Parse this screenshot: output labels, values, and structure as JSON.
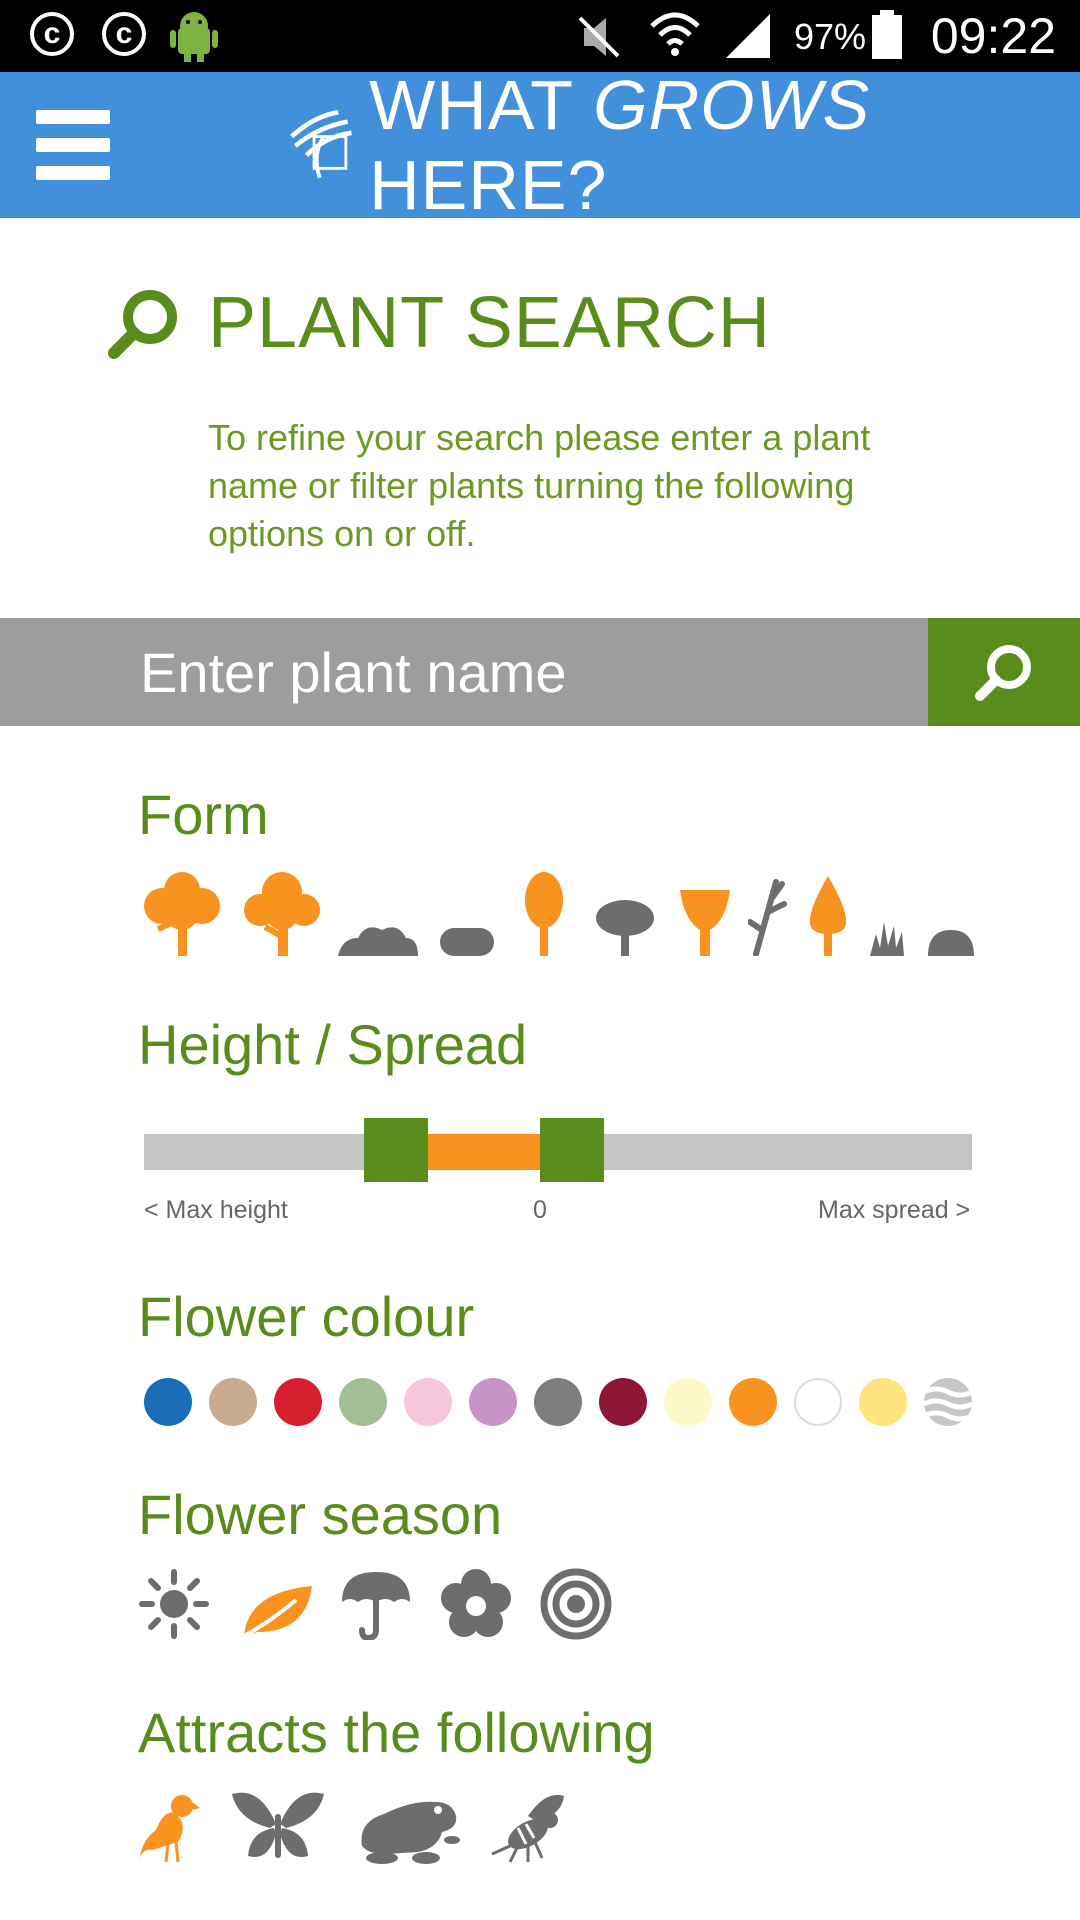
{
  "status_bar": {
    "battery": "97%",
    "time": "09:22",
    "icons": [
      "copyright-icon",
      "copyright-icon",
      "android-icon",
      "mute-icon",
      "wifi-icon",
      "signal-icon",
      "battery-icon"
    ]
  },
  "app_bar": {
    "title_part1": "WHAT ",
    "title_part2": "GROWS",
    "title_part3": " HERE?",
    "colors": {
      "bar": "#4290dc"
    }
  },
  "page": {
    "title": "PLANT SEARCH",
    "description": "To refine your search please enter a plant name or filter plants turning the following options on or off."
  },
  "search": {
    "placeholder": "Enter plant name"
  },
  "form": {
    "label": "Form",
    "items": [
      {
        "name": "tree-broad",
        "active": true
      },
      {
        "name": "tree-spreading",
        "active": true
      },
      {
        "name": "shrub-low",
        "active": false
      },
      {
        "name": "shrub-mound",
        "active": false
      },
      {
        "name": "tree-columnar",
        "active": true
      },
      {
        "name": "tree-umbrella",
        "active": false
      },
      {
        "name": "tree-vase",
        "active": true
      },
      {
        "name": "bamboo",
        "active": false
      },
      {
        "name": "tree-conical",
        "active": true
      },
      {
        "name": "grass",
        "active": false
      },
      {
        "name": "groundcover",
        "active": false
      }
    ]
  },
  "height_spread": {
    "label": "Height / Spread",
    "min_label": "< Max height",
    "center_label": "0",
    "max_label": "Max spread >"
  },
  "flower_colour": {
    "label": "Flower colour",
    "colors": [
      "#1b6db8",
      "#c8aa8e",
      "#d6202e",
      "#a3bd97",
      "#f6c6dd",
      "#c894c8",
      "#7d7d7d",
      "#8c1634",
      "#fdf8c8",
      "#f7931e",
      "#ffffff",
      "#fde47c",
      "mixed"
    ]
  },
  "flower_season": {
    "label": "Flower season",
    "items": [
      {
        "name": "summer",
        "active": false
      },
      {
        "name": "autumn",
        "active": true
      },
      {
        "name": "winter",
        "active": false
      },
      {
        "name": "spring",
        "active": false
      },
      {
        "name": "all-year",
        "active": false
      }
    ]
  },
  "attracts": {
    "label": "Attracts the following",
    "items": [
      {
        "name": "bird",
        "active": true
      },
      {
        "name": "butterfly",
        "active": false
      },
      {
        "name": "frog",
        "active": false
      },
      {
        "name": "bee",
        "active": false
      }
    ]
  }
}
